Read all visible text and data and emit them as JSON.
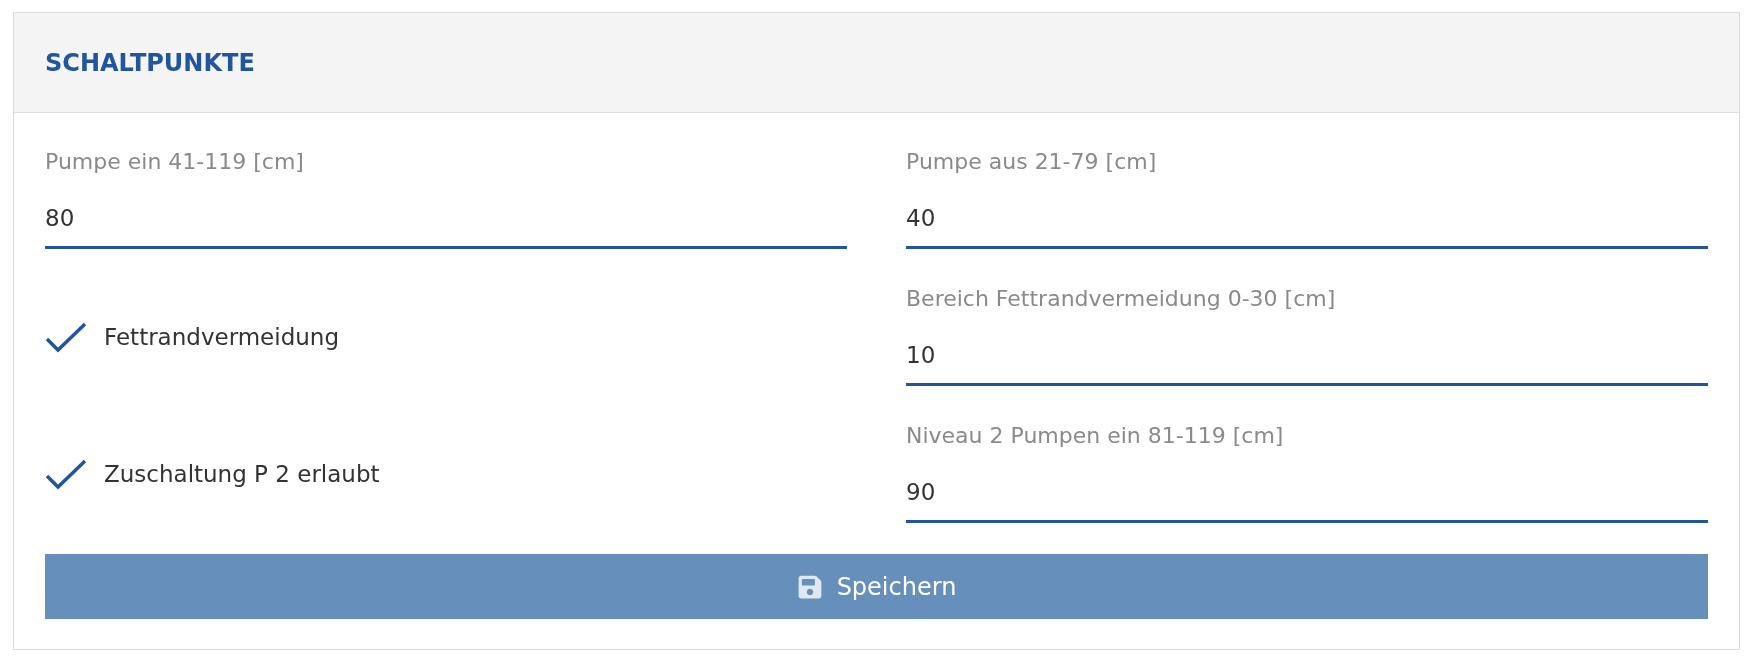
{
  "panel": {
    "title": "SCHALTPUNKTE"
  },
  "rows": [
    {
      "cells": [
        {
          "kind": "field",
          "label": "Pumpe ein 41-119 [cm]",
          "value": "80"
        },
        {
          "kind": "field",
          "label": "Pumpe aus 21-79 [cm]",
          "value": "40"
        }
      ]
    },
    {
      "cells": [
        {
          "kind": "checkbox",
          "label": "Fettrandvermeidung",
          "checked": true
        },
        {
          "kind": "field",
          "label": "Bereich Fettrandvermeidung 0-30 [cm]",
          "value": "10"
        }
      ]
    },
    {
      "cells": [
        {
          "kind": "checkbox",
          "label": "Zuschaltung P 2 erlaubt",
          "checked": true
        },
        {
          "kind": "field",
          "label": "Niveau 2 Pumpen ein 81-119 [cm]",
          "value": "90"
        }
      ]
    }
  ],
  "save_button": {
    "label": "Speichern"
  }
}
